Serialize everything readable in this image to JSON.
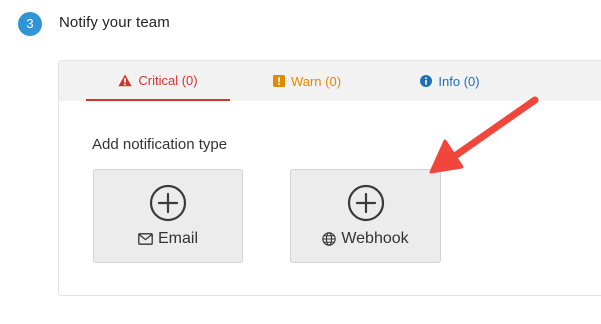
{
  "step": {
    "number": "3",
    "title": "Notify your team"
  },
  "tabs": [
    {
      "label": "Critical (0)",
      "icon": "warning-triangle-icon",
      "color": "#d9322b",
      "active": true
    },
    {
      "label": "Warn (0)",
      "icon": "exclamation-square-icon",
      "color": "#e08a00",
      "active": false
    },
    {
      "label": "Info (0)",
      "icon": "info-circle-icon",
      "color": "#1f6fb5",
      "active": false
    }
  ],
  "section": {
    "heading": "Add notification type"
  },
  "notification_types": [
    {
      "label": "Email",
      "icon": "envelope-icon"
    },
    {
      "label": "Webhook",
      "icon": "globe-icon"
    }
  ],
  "annotation": {
    "arrow_color": "#f0463c",
    "points_to": "webhook-card"
  },
  "colors": {
    "step_badge": "#2f95d6",
    "tab_bar_bg": "#f2f2f2",
    "card_bg": "#ececec"
  }
}
